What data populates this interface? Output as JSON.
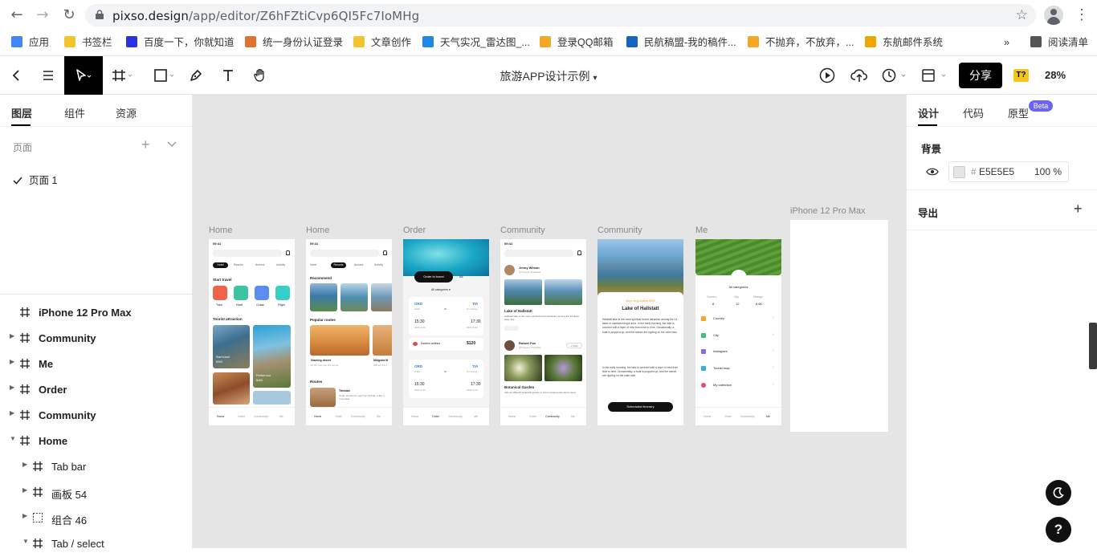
{
  "browser": {
    "url_host": "pixso.design",
    "url_path": "/app/editor/Z6hFZtiCvp6QI5Fc7IoMHg"
  },
  "bookmarks": [
    {
      "label": "应用",
      "color": "#4285f4"
    },
    {
      "label": "书签栏",
      "color": "#f4c430"
    },
    {
      "label": "百度一下，你就知道",
      "color": "#2932e1"
    },
    {
      "label": "统一身份认证登录",
      "color": "#e0712f"
    },
    {
      "label": "文章创作",
      "color": "#f4c430"
    },
    {
      "label": "天气实况_雷达图_...",
      "color": "#1e88e5"
    },
    {
      "label": "登录QQ邮箱",
      "color": "#f5a623"
    },
    {
      "label": "民航稿盟-我的稿件...",
      "color": "#1565c0"
    },
    {
      "label": "不抛弃，不放弃，...",
      "color": "#f5a623"
    },
    {
      "label": "东航邮件系统",
      "color": "#f0a500"
    },
    {
      "label": "»",
      "color": ""
    },
    {
      "label": "阅读清单",
      "color": "#555555"
    }
  ],
  "toolbar": {
    "title": "旅游APP设计示例",
    "title_caret": "▾",
    "share_label": "分享",
    "t_mark": "T?",
    "zoom": "28%"
  },
  "left_panel": {
    "tabs": [
      "图层",
      "组件",
      "资源"
    ],
    "pages_label": "页面",
    "page_1": "页面 1",
    "layers": [
      {
        "name": "iPhone 12 Pro Max",
        "bold": true,
        "indent": 0,
        "arrow": false,
        "icon": "frame"
      },
      {
        "name": "Community",
        "bold": true,
        "indent": 0,
        "arrow": "right",
        "icon": "frame"
      },
      {
        "name": "Me",
        "bold": true,
        "indent": 0,
        "arrow": "right",
        "icon": "frame"
      },
      {
        "name": "Order",
        "bold": true,
        "indent": 0,
        "arrow": "right",
        "icon": "frame"
      },
      {
        "name": "Community",
        "bold": true,
        "indent": 0,
        "arrow": "right",
        "icon": "frame"
      },
      {
        "name": "Home",
        "bold": true,
        "indent": 0,
        "arrow": "down",
        "icon": "frame"
      },
      {
        "name": "Tab bar",
        "bold": false,
        "indent": 1,
        "arrow": "right",
        "icon": "frame"
      },
      {
        "name": "画板 54",
        "bold": false,
        "indent": 1,
        "arrow": "right",
        "icon": "frame"
      },
      {
        "name": "组合 46",
        "bold": false,
        "indent": 1,
        "arrow": "right",
        "icon": "group"
      },
      {
        "name": "Tab / select",
        "bold": false,
        "indent": 1,
        "arrow": "down",
        "icon": "frame"
      }
    ]
  },
  "canvas": {
    "background": "#E5E5E5",
    "frames": [
      {
        "label": "Home"
      },
      {
        "label": "Home"
      },
      {
        "label": "Order"
      },
      {
        "label": "Community"
      },
      {
        "label": "Community"
      },
      {
        "label": "Me"
      },
      {
        "label": "iPhone 12 Pro Max"
      }
    ],
    "home1": {
      "time": "09:41",
      "tabs": [
        "Hotel",
        "Resorts",
        "Around",
        "Activity"
      ],
      "start_travel": "Start travel",
      "categories": [
        "Train",
        "Hotel",
        "Cruise",
        "Flight"
      ],
      "tourist_attraction": "Tourist attraction",
      "card1": "Start travel",
      "card1_price": "$300",
      "card2": "Festive tour",
      "card2_price": "$400",
      "nav": [
        "Home",
        "Order",
        "Community",
        "Me"
      ]
    },
    "home2": {
      "time": "09:41",
      "tabs": [
        "Hotel",
        "Resorts",
        "Around",
        "Activity"
      ],
      "recommend": "Recommend",
      "popular": "Popular routes",
      "route1": "Xiaming desert",
      "route1_sub": "20 km from the city center",
      "route2": "Mingsha M",
      "route2_sub": "300 km from",
      "routes": "Routes",
      "route3": "Trinidad",
      "route3_sub": "Cuba, across the sea from Florida, is like a \"crocodile\"",
      "nav": [
        "Home",
        "Order",
        "Community",
        "Me"
      ]
    },
    "order": {
      "order_to_travel": "Order to travel",
      "all": "All",
      "all_categories": "All categories ▾",
      "from": "ORD",
      "from_city": "Arabi",
      "to": "TIA",
      "to_city": "Ko Chang",
      "duration": "3h",
      "dep": "15:30",
      "arr": "17:30",
      "date1": "2021-2-23",
      "date2": "2021-2-23",
      "airline": "Eastern airlines",
      "price": "$120",
      "nav": [
        "Home",
        "Order",
        "Community",
        "Me"
      ]
    },
    "community1": {
      "time": "09:41",
      "user1": "Jenny Wilson",
      "user1_sub": "@Traveler  #Hallstatt",
      "post1": "Lake of Hallstatt",
      "post1_text": "Hallstatt lake is the most spiritual tourist attraction among the 14 lakes. area, this...",
      "user2": "Robert Fox",
      "user2_sub": "@Traveler  #Traveller",
      "follow": "+ Flow",
      "post2": "Botanical Garden",
      "post2_text": "Xiamen Wanshi botanical garden is rich in content and vast in area.",
      "nav": [
        "Home",
        "Order",
        "Community",
        "Me"
      ]
    },
    "community2": {
      "meta": "Mayo long  Austria  $999",
      "title": "Lake of Hallstatt",
      "body1": "Hallstatt lake is the most spiritual tourist attraction among the 14 lakes in salzkammergut area. In the early morning, the lake is covered with a layer of mist from time to time. Occasionally, a boat is propped up, and the waves are rippling on the calm lake.",
      "body2": "In the early morning, the lake is covered with a layer of mist from time to time. Occasionally, a boat is propped up, and the waves are rippling on the calm lake.",
      "button": "Scheduled itinerary"
    },
    "me": {
      "all_categories": "All categories",
      "stats": [
        {
          "label": "Country",
          "value": "8"
        },
        {
          "label": "City",
          "value": "12"
        },
        {
          "label": "Mileage",
          "value": "8.6K"
        }
      ],
      "menu": [
        "Country",
        "City",
        "Instagram",
        "Tourist map",
        "My collection"
      ],
      "nav": [
        "Home",
        "Order",
        "Community",
        "Me"
      ]
    }
  },
  "right_panel": {
    "tabs": [
      "设计",
      "代码",
      "原型"
    ],
    "beta": "Beta",
    "background_label": "背景",
    "hash": "#",
    "hex": "E5E5E5",
    "opacity": "100 %",
    "export_label": "导出",
    "help": "?"
  }
}
